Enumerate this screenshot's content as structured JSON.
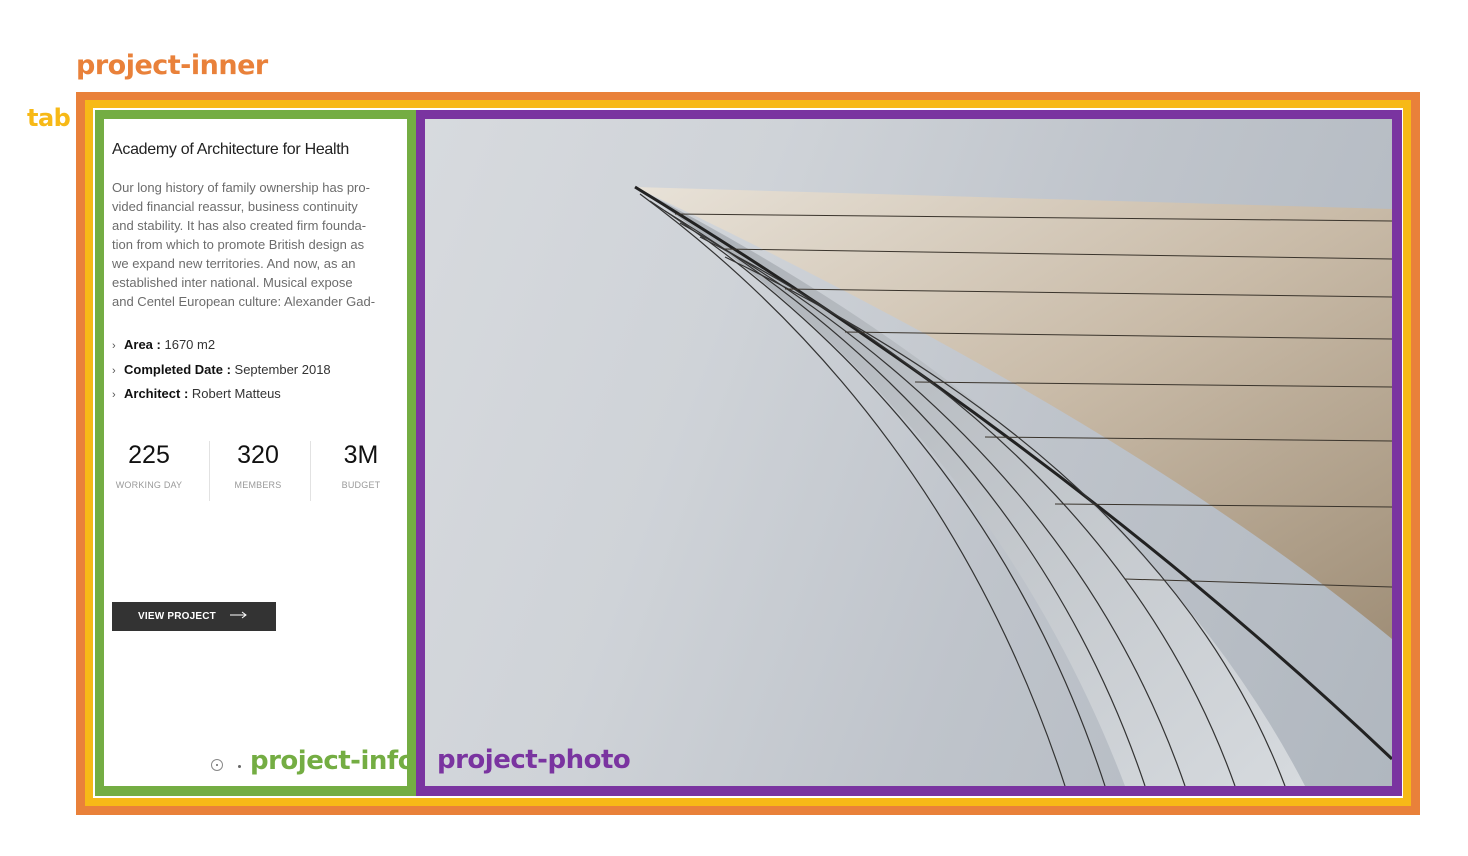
{
  "labels": {
    "project_inner": "project-inner",
    "tab": "tab",
    "project_info": "project-info",
    "project_photo": "project-photo"
  },
  "project": {
    "title": "Academy of Architecture for Health",
    "description": "Our long history of family ownership has pro-\nvided financial reassur, business continuity\nand stability. It has also created firm founda-\ntion from which to promote British design as\nwe expand new territories. And now, as an\nestablished inter national. Musical expose\nand Centel European culture: Alexander Gad-",
    "specs": [
      {
        "label": "Area",
        "value": "1670 m2"
      },
      {
        "label": "Completed Date",
        "value": "September 2018"
      },
      {
        "label": "Architect",
        "value": "Robert Matteus"
      }
    ],
    "stats": [
      {
        "value": "225",
        "caption": "WORKING DAY"
      },
      {
        "value": "320",
        "caption": "MEMBERS"
      },
      {
        "value": "3M",
        "caption": "BUDGET"
      }
    ],
    "button_label": "VIEW PROJECT"
  },
  "colors": {
    "project_inner": "#e9813a",
    "tab": "#f7b917",
    "project_info": "#74ad43",
    "project_photo": "#7a34a0",
    "button": "#333333"
  },
  "icons": [
    "chevron-right-icon",
    "arrow-right-icon",
    "radio-icon"
  ]
}
